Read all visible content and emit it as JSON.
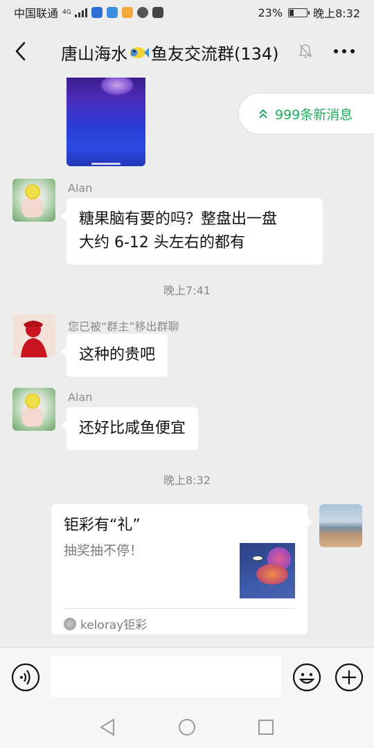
{
  "status_bar": {
    "carrier": "中国联通",
    "network": "4G",
    "battery_percent": "23%",
    "time": "晚上8:32",
    "battery_level": 0.23
  },
  "header": {
    "title_before_emoji": "唐山海水",
    "title_after_emoji": "鱼友交流群(134)",
    "emoji_icon": "fish-emoji-icon"
  },
  "new_messages_pill": {
    "label": "999条新消息"
  },
  "messages": [
    {
      "sender": "Alan",
      "lines": [
        "糖果脑有要的吗？整盘出一盘",
        "大约 6-12 头左右的都有"
      ]
    },
    {
      "timestamp": "晚上7:41"
    },
    {
      "sender": "您已被“群主”移出群聊",
      "text": "这种的贵吧"
    },
    {
      "sender": "Alan",
      "text": "还好比咸鱼便宜"
    },
    {
      "timestamp": "晚上8:32"
    }
  ],
  "card_message": {
    "title": "钜彩有“礼”",
    "description": "抽奖抽不停！",
    "source": "keloray钜彩"
  },
  "input_bar": {
    "placeholder": ""
  }
}
